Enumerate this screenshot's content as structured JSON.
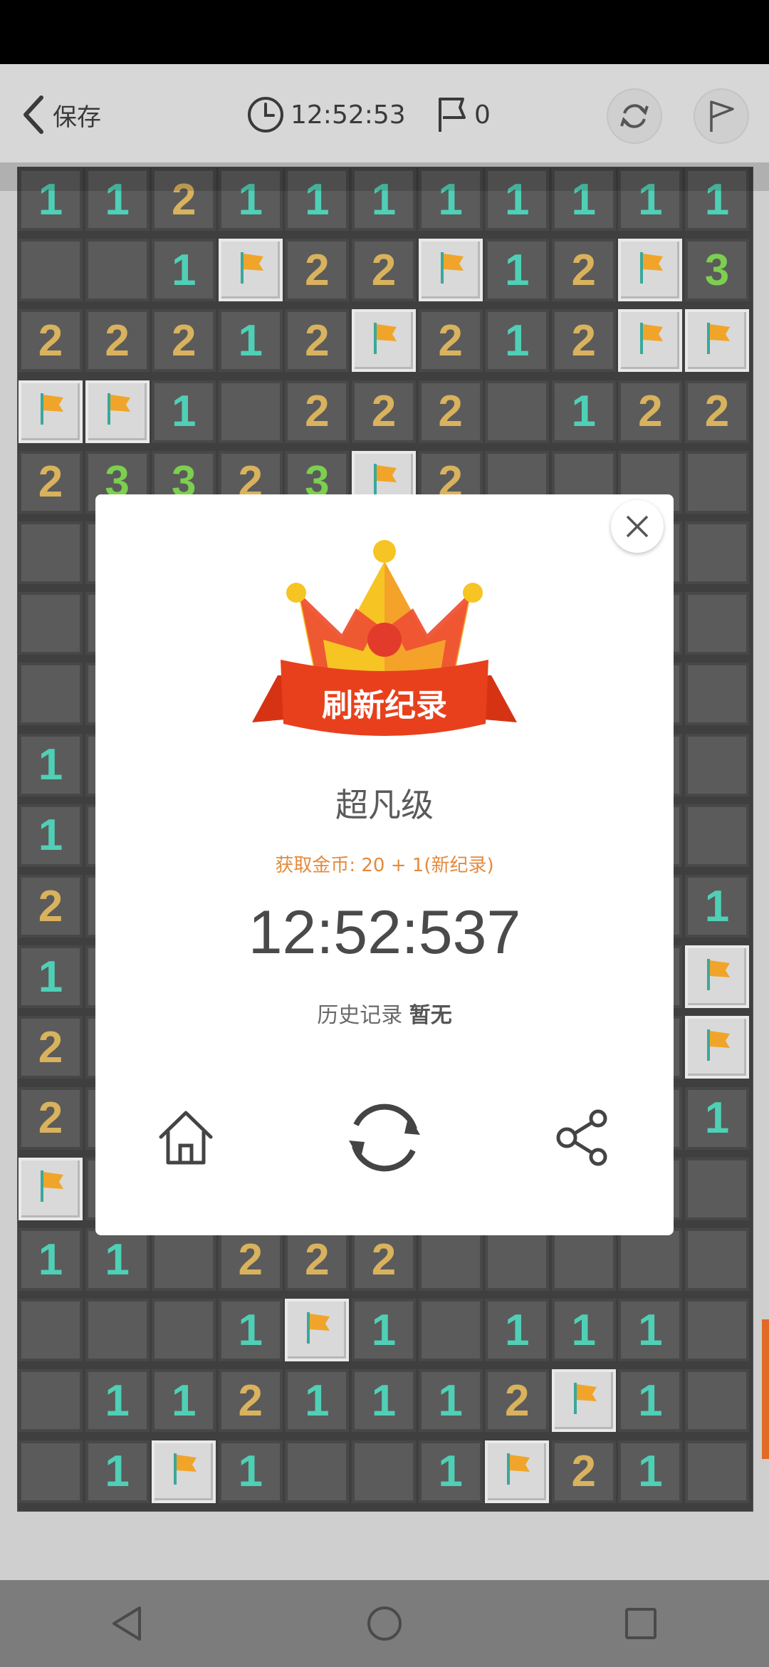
{
  "header": {
    "back_label": "保存",
    "timer": "12:52:53",
    "flag_count": "0"
  },
  "colors": {
    "n1": "#4fd0b6",
    "n2": "#d9b25e",
    "n3": "#7ccf4f",
    "accent": "#e48a3c",
    "banner": "#e8401c"
  },
  "board": {
    "cols": 11,
    "rows": [
      [
        "1",
        "1",
        "2",
        "1",
        "1",
        "1",
        "1",
        "1",
        "1",
        "1",
        "1"
      ],
      [
        "",
        "",
        "1",
        "F",
        "2",
        "2",
        "F",
        "1",
        "2",
        "F",
        "3"
      ],
      [
        "2",
        "2",
        "2",
        "1",
        "2",
        "F",
        "2",
        "1",
        "2",
        "F",
        "F"
      ],
      [
        "F",
        "F",
        "1",
        "",
        "2",
        "2",
        "2",
        "",
        "1",
        "2",
        "2"
      ],
      [
        "2",
        "3",
        "3",
        "2",
        "3",
        "F",
        "2",
        "",
        "",
        "",
        ""
      ],
      [
        "",
        "",
        "",
        "",
        "",
        "",
        "",
        "",
        "",
        "",
        ""
      ],
      [
        "",
        "",
        "",
        "",
        "",
        "",
        "",
        "",
        "",
        "",
        ""
      ],
      [
        "",
        "",
        "",
        "",
        "",
        "",
        "",
        "",
        "",
        "",
        ""
      ],
      [
        "1",
        "",
        "",
        "",
        "",
        "",
        "",
        "",
        "",
        "",
        ""
      ],
      [
        "1",
        "",
        "",
        "",
        "",
        "",
        "",
        "",
        "",
        "",
        ""
      ],
      [
        "2",
        "",
        "",
        "",
        "",
        "",
        "",
        "",
        "",
        "",
        "1"
      ],
      [
        "1",
        "",
        "",
        "",
        "",
        "",
        "",
        "",
        "",
        "",
        "F"
      ],
      [
        "2",
        "",
        "",
        "",
        "",
        "",
        "",
        "",
        "",
        "",
        "F"
      ],
      [
        "2",
        "",
        "",
        "",
        "",
        "",
        "",
        "",
        "",
        "",
        "1"
      ],
      [
        "F",
        "",
        "",
        "",
        "",
        "",
        "",
        "",
        "",
        "",
        ""
      ],
      [
        "1",
        "1",
        "",
        "2",
        "2",
        "2",
        "",
        "",
        "",
        "",
        ""
      ],
      [
        "",
        "",
        "",
        "1",
        "F",
        "1",
        "",
        "1",
        "1",
        "1",
        ""
      ],
      [
        "",
        "1",
        "1",
        "2",
        "1",
        "1",
        "1",
        "2",
        "F",
        "1",
        ""
      ],
      [
        "",
        "1",
        "F",
        "1",
        "",
        "",
        "1",
        "F",
        "2",
        "1",
        ""
      ]
    ]
  },
  "modal": {
    "banner": "刷新纪录",
    "level": "超凡级",
    "coins": "获取金币: 20 + 1(新纪录)",
    "time": "12:52:537",
    "history_label": "历史记录",
    "history_value": "暂无"
  }
}
